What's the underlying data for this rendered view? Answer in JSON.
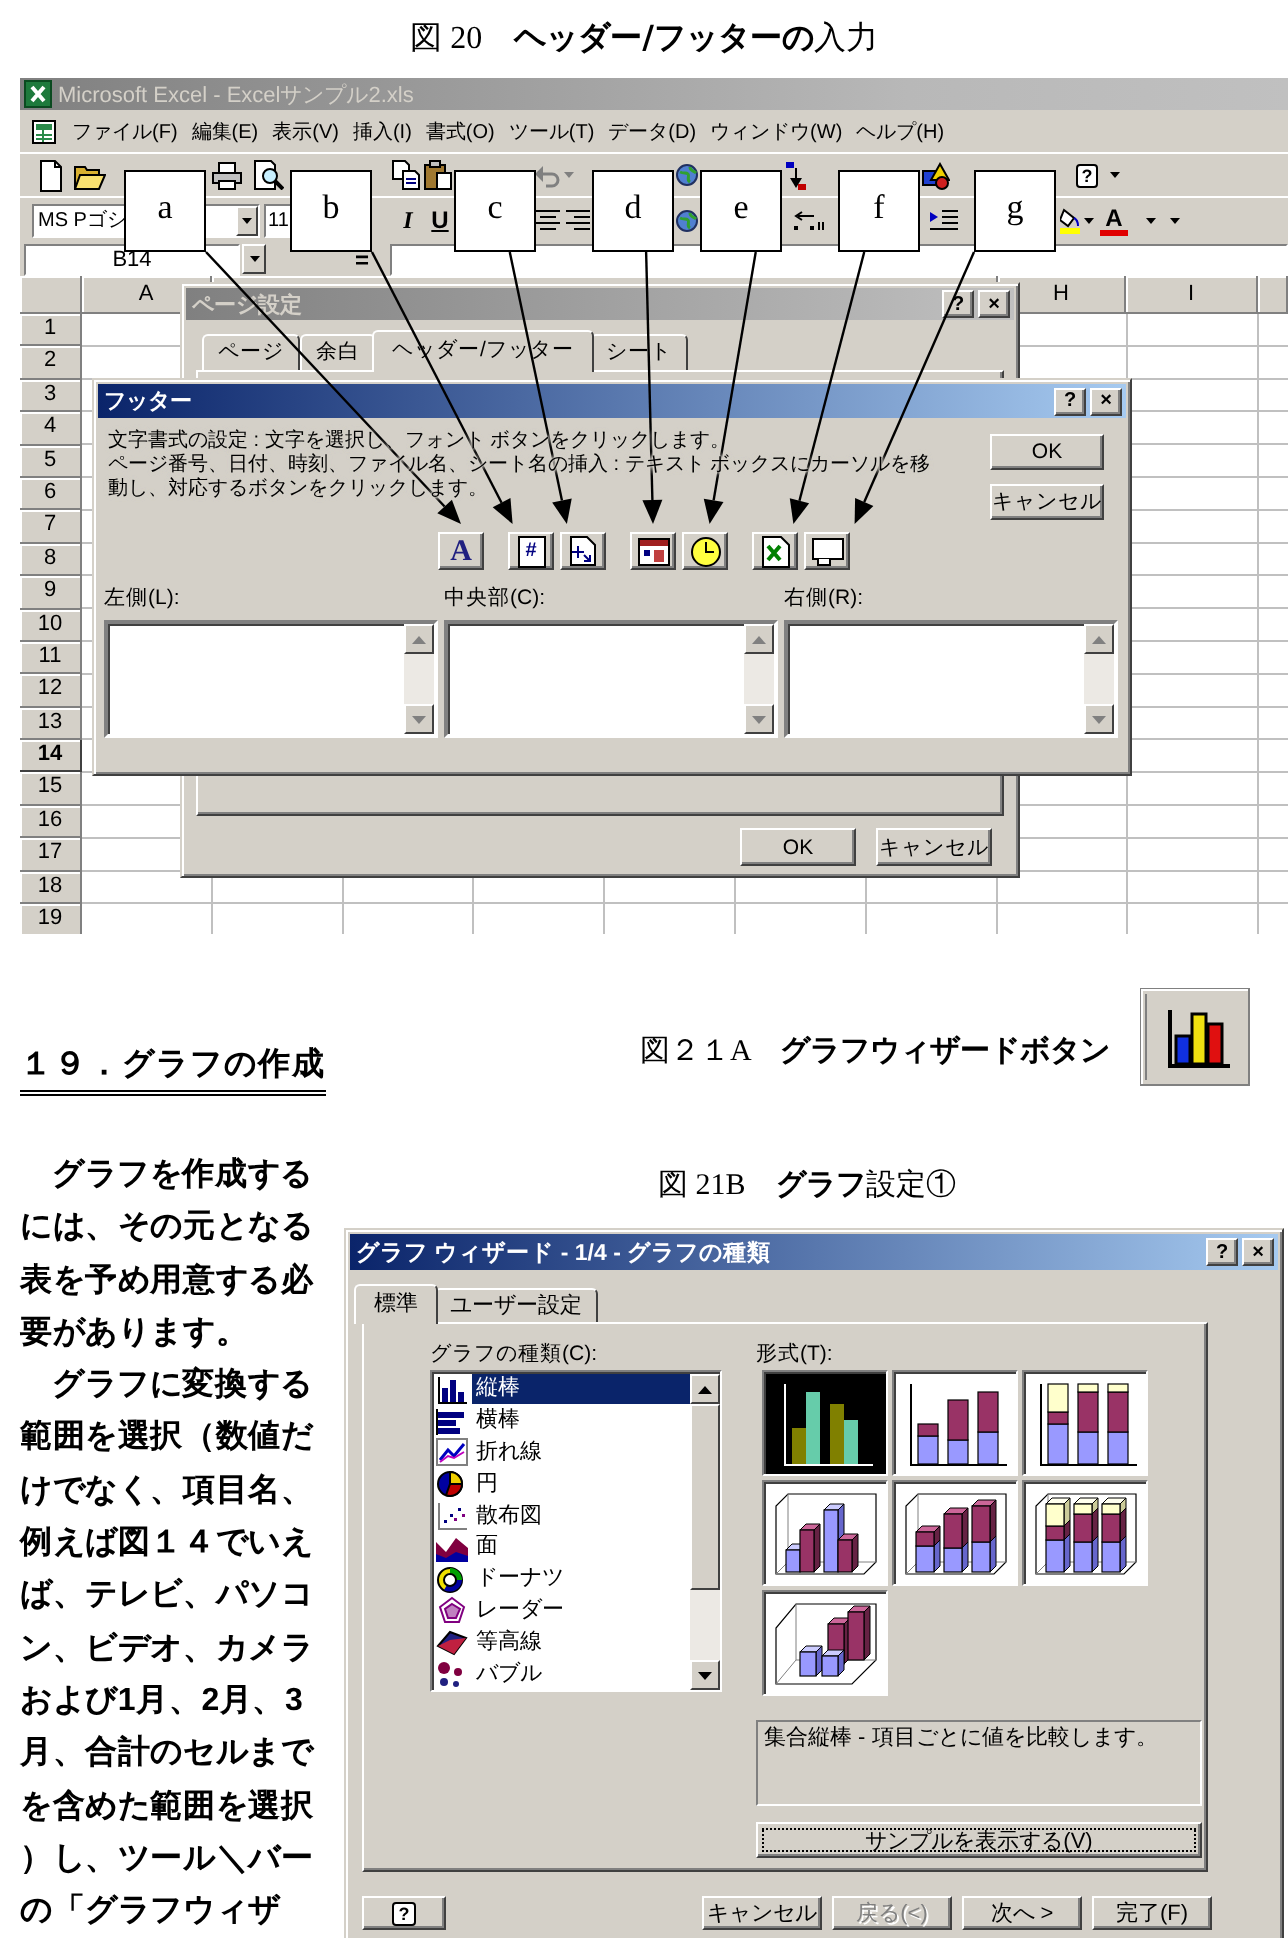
{
  "figure_20": {
    "caption": "図 20　**ヘッダー/フッターの**入力"
  },
  "excel": {
    "title": "Microsoft Excel - Excelサンプル2.xls",
    "menu": [
      "ファイル(F)",
      "編集(E)",
      "表示(V)",
      "挿入(I)",
      "書式(O)",
      "ツール(T)",
      "データ(D)",
      "ウィンドウ(W)",
      "ヘルプ(H)"
    ],
    "help_button": "?",
    "font_name": "MS Pゴシ",
    "font_size": "11",
    "format_buttons": [
      {
        "kind": "italic",
        "label": "I"
      },
      {
        "kind": "underline",
        "label": "U"
      },
      {
        "kind": "font_color",
        "label": "A"
      }
    ],
    "name_box": "B14",
    "formula_button": "=",
    "column_headers": [
      "A",
      "H",
      "I"
    ],
    "rows": [
      {
        "label": "1",
        "selected": false
      },
      {
        "label": "2",
        "selected": false
      },
      {
        "label": "3",
        "selected": false
      },
      {
        "label": "4",
        "selected": false
      },
      {
        "label": "5",
        "selected": false
      },
      {
        "label": "6",
        "selected": false
      },
      {
        "label": "7",
        "selected": false
      },
      {
        "label": "8",
        "selected": false
      },
      {
        "label": "9",
        "selected": false
      },
      {
        "label": "10",
        "selected": false
      },
      {
        "label": "11",
        "selected": false
      },
      {
        "label": "12",
        "selected": false
      },
      {
        "label": "13",
        "selected": false
      },
      {
        "label": "14",
        "selected": true
      },
      {
        "label": "15",
        "selected": false
      },
      {
        "label": "16",
        "selected": false
      },
      {
        "label": "17",
        "selected": false
      },
      {
        "label": "18",
        "selected": false
      },
      {
        "label": "19",
        "selected": false
      }
    ]
  },
  "page_setup_dialog": {
    "title": "ページ設定",
    "title_buttons": [
      "?",
      "×"
    ],
    "tabs": [
      {
        "label": "ページ",
        "selected": false
      },
      {
        "label": "余白",
        "selected": false
      },
      {
        "label": "ヘッダー/フッター",
        "selected": true
      },
      {
        "label": "シート",
        "selected": false
      }
    ],
    "buttons": [
      "OK",
      "キャンセル"
    ]
  },
  "footer_dialog": {
    "title": "フッター",
    "title_buttons": [
      "?",
      "×"
    ],
    "instructions": [
      "文字書式の設定 : 文字を選択し、フォント ボタンをクリックします。",
      "ページ番号、日付、時刻、ファイル名、シート名の挿入 : テキスト ボックスにカーソルを移動し、対応するボタンをクリックします。"
    ],
    "buttons": [
      "OK",
      "キャンセル"
    ],
    "insert_buttons": [
      {
        "kind": "font",
        "glyph": "A"
      },
      {
        "kind": "page_number",
        "glyph": "#"
      },
      {
        "kind": "page_count"
      },
      {
        "kind": "date"
      },
      {
        "kind": "time"
      },
      {
        "kind": "file_name"
      },
      {
        "kind": "sheet_name"
      }
    ],
    "sections": [
      {
        "label": "左側(L):"
      },
      {
        "label": "中央部(C):"
      },
      {
        "label": "右側(R):"
      }
    ]
  },
  "callouts": [
    "a",
    "b",
    "c",
    "d",
    "e",
    "f",
    "g"
  ],
  "section_heading": "１９．グラフの作成",
  "body_paragraphs": [
    "グラフを作成するには、その元となる表を予め用意する必要があります。",
    "グラフに変換する範囲を選択（数値だけでなく、項目名、例えば図１４でいえば、テレビ、パソコン、ビデオ、カメラおよび1月、2月、3月、合計のセルまでを含めた範囲を選択）し、ツール＼バーの「グラフウィザ"
  ],
  "figure_21a": {
    "caption": "図２１A　**グラフウィザードボタン**"
  },
  "figure_21b": {
    "caption": "図 21B　**グラフ**設定①"
  },
  "chart_wizard": {
    "title": "グラフ ウィザード - 1/4 - グラフの種類",
    "title_buttons": [
      "?",
      "×"
    ],
    "tabs": [
      {
        "label": "標準",
        "selected": true
      },
      {
        "label": "ユーザー設定",
        "selected": false
      }
    ],
    "chart_type_label": "グラフの種類(C):",
    "chart_types": [
      {
        "label": "縦棒",
        "selected": true
      },
      {
        "label": "横棒",
        "selected": false
      },
      {
        "label": "折れ線",
        "selected": false
      },
      {
        "label": "円",
        "selected": false
      },
      {
        "label": "散布図",
        "selected": false
      },
      {
        "label": "面",
        "selected": false
      },
      {
        "label": "ドーナツ",
        "selected": false
      },
      {
        "label": "レーダー",
        "selected": false
      },
      {
        "label": "等高線",
        "selected": false
      },
      {
        "label": "バブル",
        "selected": false
      }
    ],
    "subtype_label": "形式(T):",
    "subtypes": [
      {
        "selected": true
      },
      {
        "selected": false
      },
      {
        "selected": false
      },
      {
        "selected": false
      },
      {
        "selected": false
      },
      {
        "selected": false
      },
      {
        "selected": false
      }
    ],
    "description": "集合縦棒 - 項目ごとに値を比較します。",
    "preview_button": "サンプルを表示する(V)",
    "help_button": "?",
    "buttons": [
      {
        "label": "キャンセル",
        "disabled": false
      },
      {
        "label": "戻る(<)",
        "disabled": true
      },
      {
        "label": "次へ >",
        "disabled": false
      },
      {
        "label": "完了(F)",
        "disabled": false
      }
    ]
  }
}
